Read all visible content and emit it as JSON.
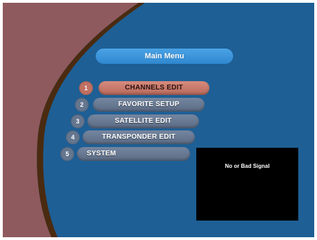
{
  "main_menu": {
    "title": "Main Menu",
    "items": [
      {
        "number": "1",
        "label": "CHANNELS EDIT",
        "selected": true
      },
      {
        "number": "2",
        "label": "FAVORITE SETUP",
        "selected": false
      },
      {
        "number": "3",
        "label": "SATELLITE EDIT",
        "selected": false
      },
      {
        "number": "4",
        "label": "TRANSPONDER EDIT",
        "selected": false
      },
      {
        "number": "5",
        "label": "SYSTEM",
        "selected": false
      }
    ]
  },
  "preview": {
    "message": "No or Bad Signal"
  },
  "colors": {
    "background_blue": "#1e5f95",
    "side_panel_mauve": "#8e5a5e",
    "border_brown": "#4a2b10",
    "title_pill_blue": "#3e96dc",
    "selected_pill": "#c97a6c",
    "normal_pill": "#687993"
  }
}
